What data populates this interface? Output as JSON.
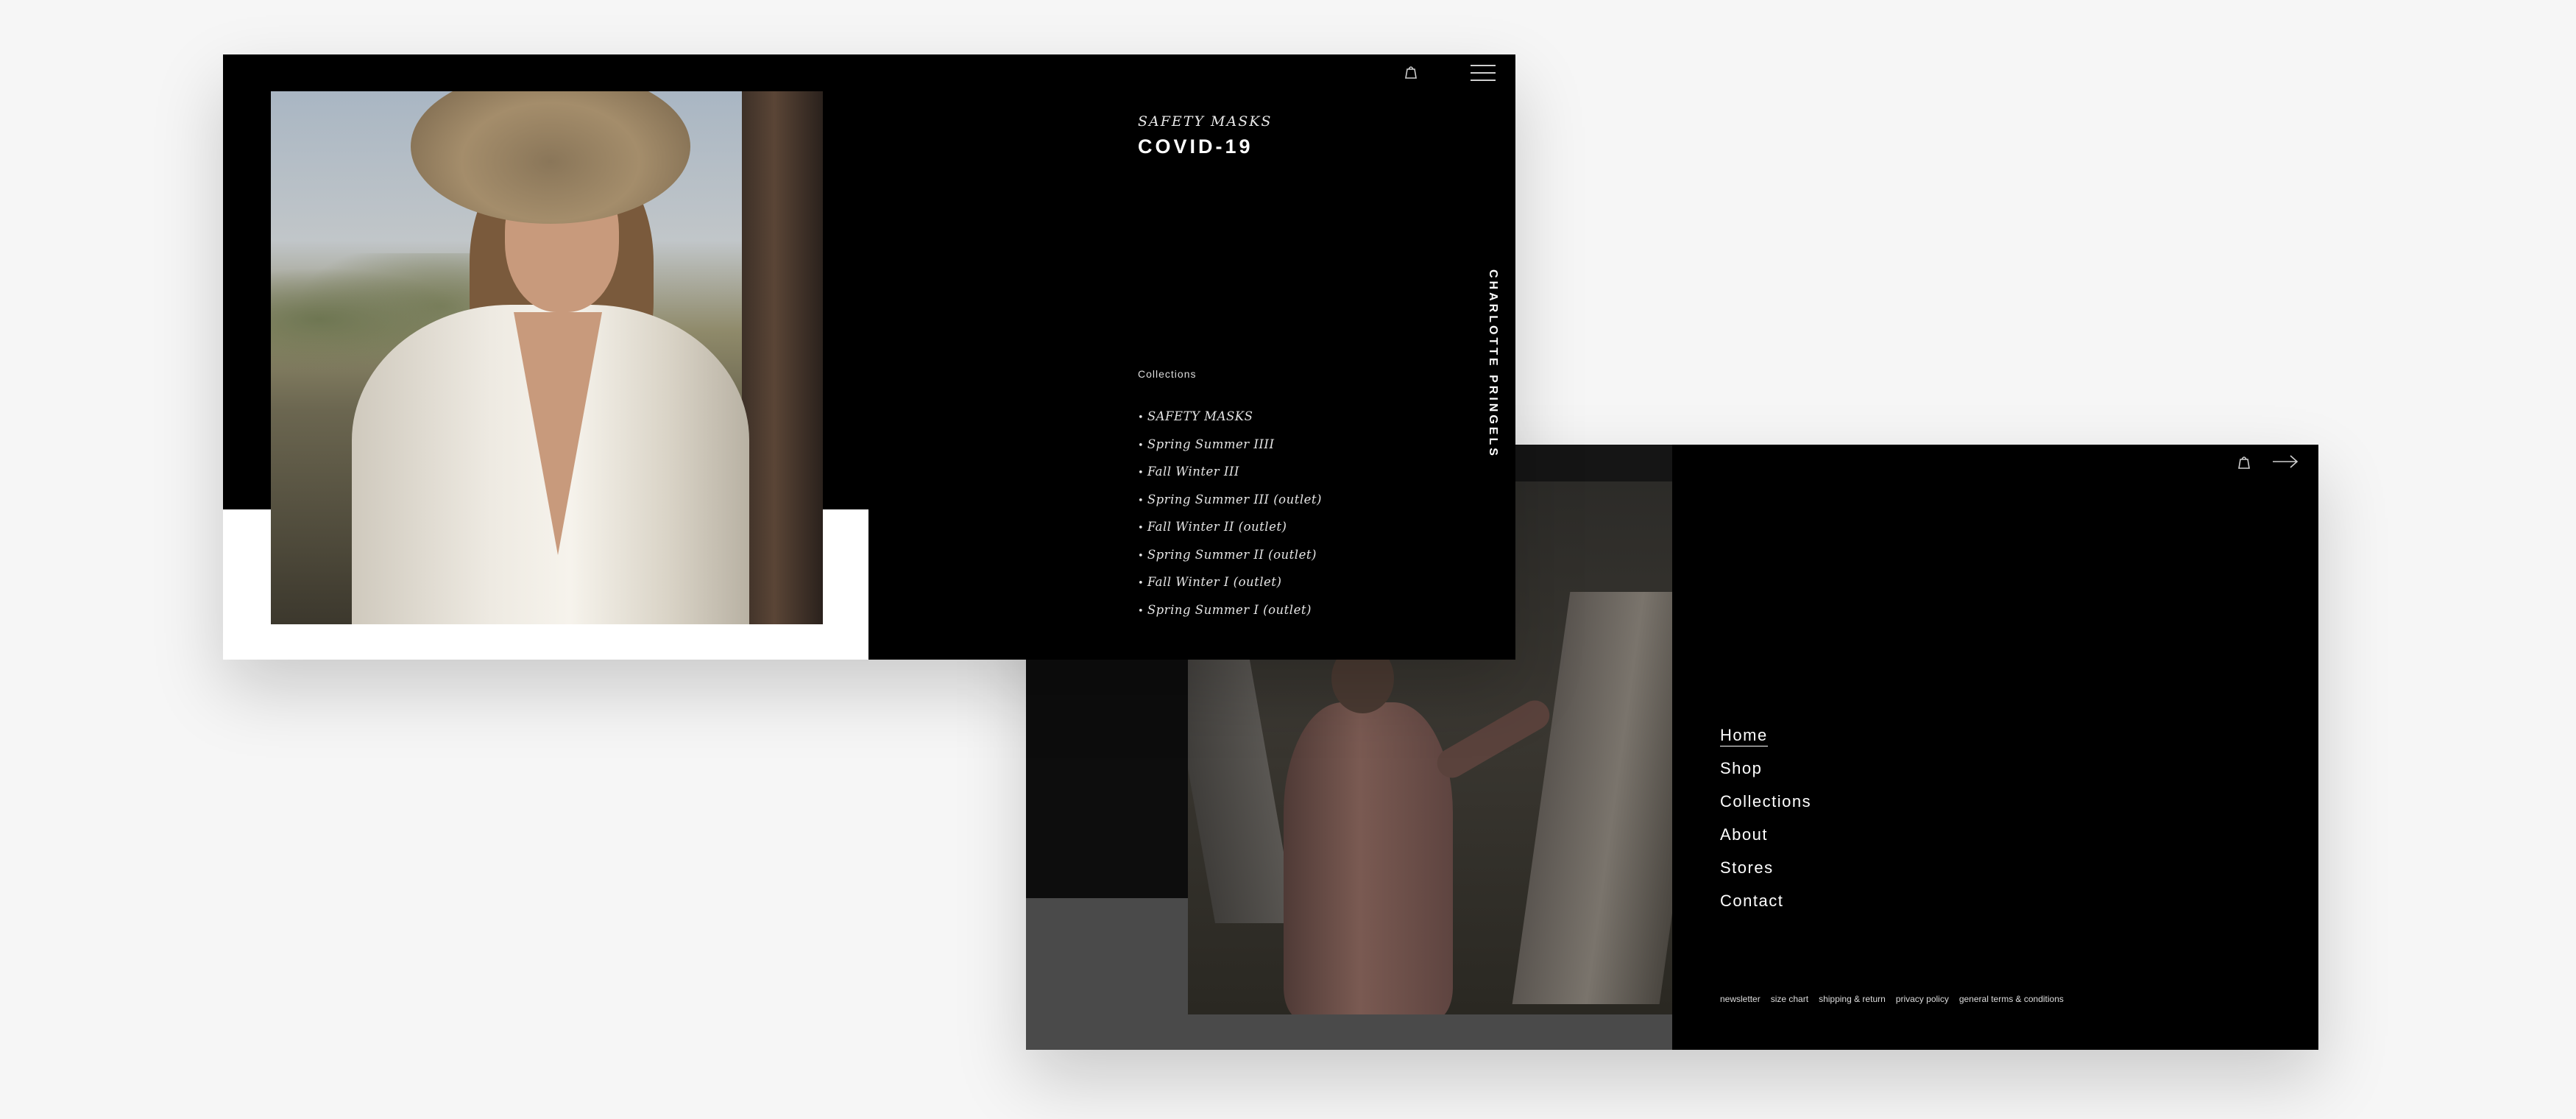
{
  "screen1": {
    "kicker": "SAFETY MASKS",
    "title": "COVID-19",
    "collections_heading": "Collections",
    "collections": [
      "SAFETY MASKS",
      "Spring Summer IIII",
      "Fall Winter III",
      "Spring Summer III (outlet)",
      "Fall Winter II (outlet)",
      "Spring Summer II (outlet)",
      "Fall Winter I (outlet)",
      "Spring Summer I (outlet)"
    ],
    "brand": "CHARLOTTE PRINGELS",
    "icons": [
      "shopping-bag-icon",
      "hamburger-menu-icon"
    ]
  },
  "screen2": {
    "nav": [
      "Home",
      "Shop",
      "Collections",
      "About",
      "Stores",
      "Contact"
    ],
    "active_nav": "Home",
    "footer_links": [
      "newsletter",
      "size chart",
      "shipping & return",
      "privacy policy",
      "general terms & conditions"
    ],
    "icons": [
      "shopping-bag-icon",
      "arrow-right-icon"
    ]
  },
  "colors": {
    "background": "#f6f6f6",
    "panel": "#000000",
    "text": "#ffffff"
  }
}
